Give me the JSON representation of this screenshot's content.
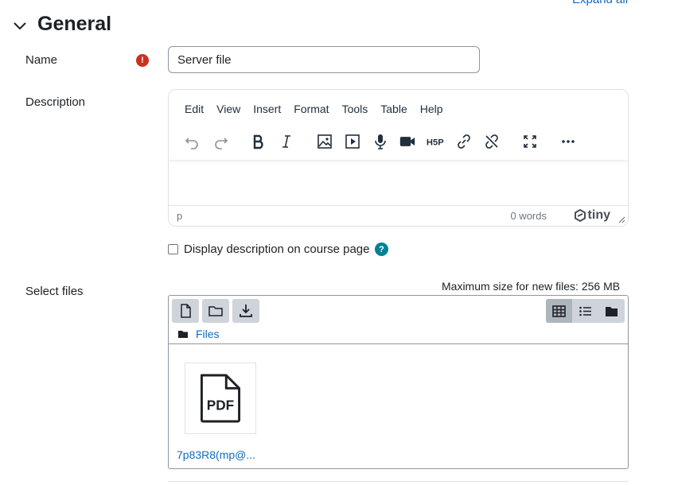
{
  "header": {
    "expand_all": "Expand all",
    "section_title": "General"
  },
  "name_field": {
    "label": "Name",
    "value": "Server file",
    "required_symbol": "!"
  },
  "description": {
    "label": "Description",
    "menubar": [
      "Edit",
      "View",
      "Insert",
      "Format",
      "Tools",
      "Table",
      "Help"
    ],
    "toolbar_icons": [
      "undo-icon",
      "redo-icon",
      "bold-icon",
      "italic-icon",
      "image-icon",
      "media-icon",
      "record-audio-icon",
      "record-video-icon",
      "h5p-icon",
      "link-icon",
      "unlink-icon",
      "fullscreen-icon",
      "more-icon"
    ],
    "status_path": "p",
    "word_count": "0 words",
    "brand": "tiny"
  },
  "display_description": {
    "label": "Display description on course page",
    "checked": false,
    "help_symbol": "?"
  },
  "select_files": {
    "label": "Select files",
    "max_size": "Maximum size for new files: 256 MB",
    "path_label": "Files",
    "active_view": "icons",
    "files": [
      {
        "name": "7p83R8(mp@...",
        "type": "PDF"
      }
    ]
  },
  "colors": {
    "link": "#0f6cbf",
    "required": "#ca3120",
    "help": "#008196",
    "text": "#1d2125"
  }
}
